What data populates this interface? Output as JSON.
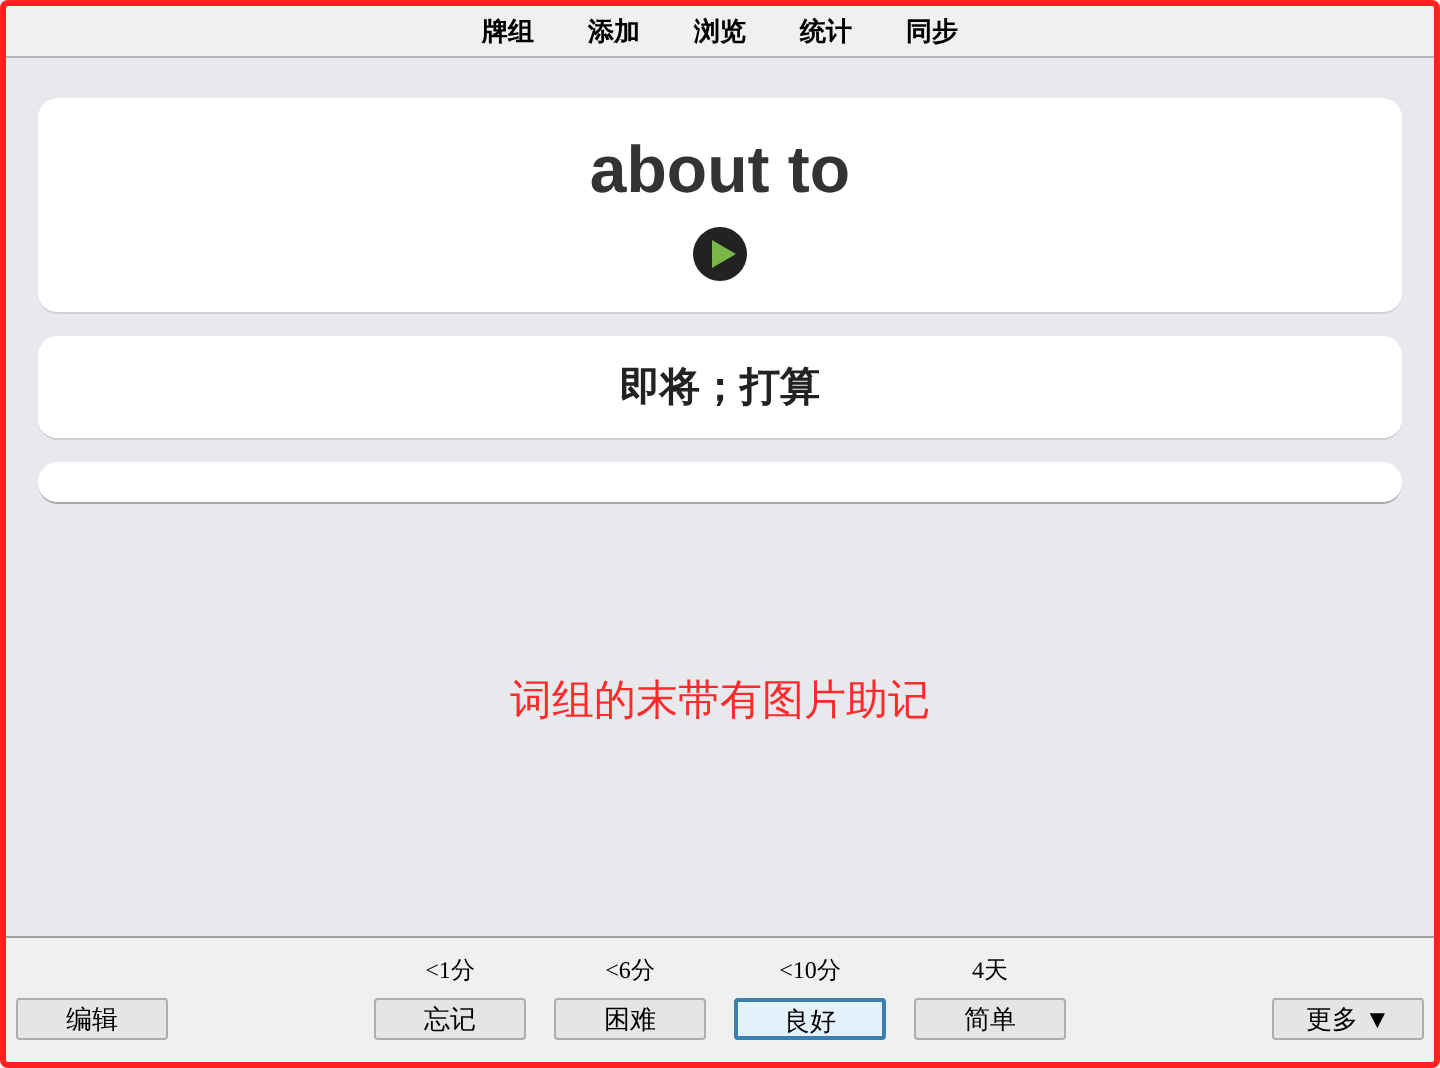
{
  "menu": [
    "牌组",
    "添加",
    "浏览",
    "统计",
    "同步"
  ],
  "card": {
    "word": "about to",
    "meaning": "即将；打算"
  },
  "note": "词组的末带有图片助记",
  "edit_button": "编辑",
  "answers": [
    {
      "interval": "<1分",
      "label": "忘记",
      "selected": false
    },
    {
      "interval": "<6分",
      "label": "困难",
      "selected": false
    },
    {
      "interval": "<10分",
      "label": "良好",
      "selected": true
    },
    {
      "interval": "4天",
      "label": "简单",
      "selected": false
    }
  ],
  "more_button": "更多 ▼"
}
